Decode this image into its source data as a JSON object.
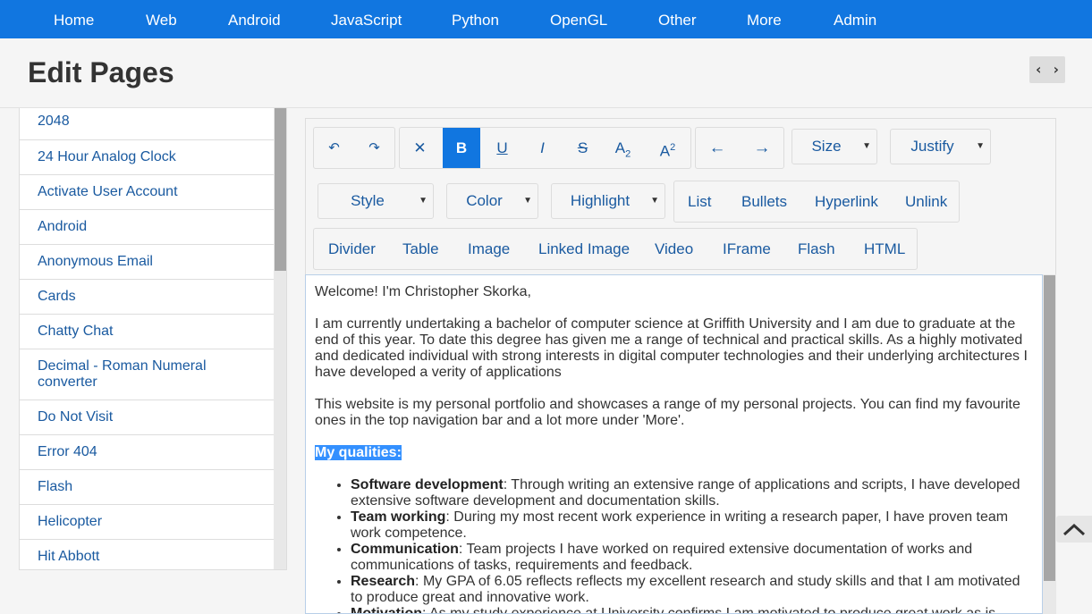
{
  "nav": [
    "Home",
    "Web",
    "Android",
    "JavaScript",
    "Python",
    "OpenGL",
    "Other",
    "More",
    "Admin"
  ],
  "header": {
    "title": "Edit Pages",
    "code_toggle": "‹ ›"
  },
  "sidebar": {
    "items": [
      "2048",
      "24 Hour Analog Clock",
      "Activate User Account",
      "Android",
      "Anonymous Email",
      "Cards",
      "Chatty Chat",
      "Decimal - Roman Numeral converter",
      "Do Not Visit",
      "Error 404",
      "Flash",
      "Helicopter",
      "Hit Abbott"
    ]
  },
  "toolbar": {
    "undo": "↶",
    "redo": "↷",
    "clear": "✕",
    "bold": "B",
    "underline": "U",
    "italic": "I",
    "strike": "S",
    "subscript_base": "A",
    "subscript_mark": "2",
    "superscript_base": "A",
    "superscript_mark": "2",
    "outdent": "←",
    "indent": "→",
    "size": "Size",
    "justify": "Justify",
    "style": "Style",
    "color": "Color",
    "highlight": "Highlight",
    "list": "List",
    "bullets": "Bullets",
    "hyperlink": "Hyperlink",
    "unlink": "Unlink",
    "divider": "Divider",
    "table": "Table",
    "image": "Image",
    "linked_image": "Linked Image",
    "video": "Video",
    "iframe": "IFrame",
    "flash": "Flash",
    "html": "HTML",
    "caret": "▼"
  },
  "content": {
    "greeting": "Welcome! I'm Christopher Skorka,",
    "para1": "I am currently undertaking a bachelor of computer science at Griffith University and I am due to graduate at the end of this year. To date this degree has given me a range of technical and practical skills. As a highly motivated and dedicated individual with strong interests in digital computer technologies and their underlying architectures I have developed a verity of applications",
    "para2": "This website is my personal portfolio and showcases a range of my personal projects. You can find my favourite ones in the top navigation bar and a lot more under 'More'.",
    "qualities_heading": "My qualities:",
    "qualities": [
      {
        "title": "Software development",
        "text": ": Through writing an extensive range of applications and scripts, I have developed extensive software development and documentation skills."
      },
      {
        "title": "Team working",
        "text": ": During my most recent work experience in writing a research paper, I have proven team work competence."
      },
      {
        "title": "Communication",
        "text": ": Team projects I have worked on required extensive documentation of works and communications of tasks, requirements and feedback."
      },
      {
        "title": "Research",
        "text": ": My GPA of 6.05 reflects reflects my excellent research and study skills and that I am motivated to produce great and innovative work."
      },
      {
        "title": "Motivation",
        "text": ": As my study experience at University confirms I am motivated to produce great work as is"
      }
    ]
  },
  "colors": {
    "nav_bg": "#1176e0",
    "link": "#1a5aa0",
    "highlight": "#3390ff"
  }
}
